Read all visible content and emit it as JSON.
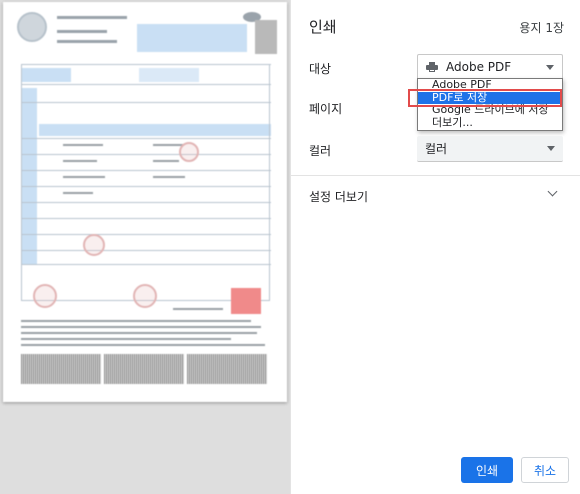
{
  "dialog": {
    "title": "인쇄",
    "sheet_count": "용지 1장"
  },
  "settings": {
    "destination": {
      "label": "대상",
      "value": "Adobe PDF",
      "icon": "printer-icon",
      "options": [
        "Adobe PDF",
        "PDF로 저장",
        "Google 드라이브에 저장",
        "더보기..."
      ],
      "highlighted_option": "PDF로 저장"
    },
    "pages": {
      "label": "페이지"
    },
    "color": {
      "label": "컬러",
      "value": "컬러"
    },
    "more_settings": {
      "label": "설정 더보기"
    }
  },
  "buttons": {
    "print": "인쇄",
    "cancel": "취소"
  },
  "colors": {
    "accent": "#1a73e8",
    "selected_option": "#1e72e8",
    "highlight_box": "#e24b4b"
  }
}
